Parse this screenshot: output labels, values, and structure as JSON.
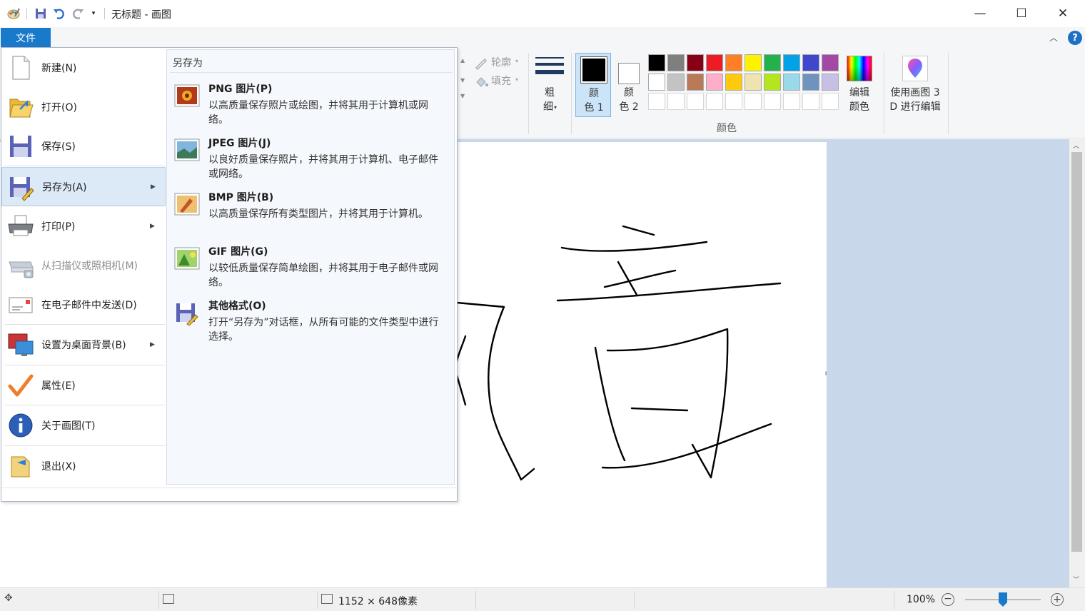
{
  "window": {
    "title": "无标题 - 画图",
    "minimize_glyph": "—",
    "maximize_glyph": "☐",
    "close_glyph": "✕"
  },
  "ribbon": {
    "file_tab": "文件",
    "outline_label": "轮廓",
    "fill_label": "填充",
    "size_label_1": "粗",
    "size_label_2": "细",
    "color1_label_1": "颜",
    "color1_label_2": "色 1",
    "color2_label_1": "颜",
    "color2_label_2": "色 2",
    "edit_colors_1": "编辑",
    "edit_colors_2": "颜色",
    "paint3d_1": "使用画图 3",
    "paint3d_2": "D 进行编辑",
    "colors_group": "颜色",
    "color1_value": "#000000",
    "color2_value": "#ffffff",
    "palette_row1": [
      "#000000",
      "#7f7f7f",
      "#880015",
      "#ed1c24",
      "#ff7f27",
      "#fff200",
      "#22b14c",
      "#00a2e8",
      "#3f48cc",
      "#a349a4"
    ],
    "palette_row2": [
      "#ffffff",
      "#c3c3c3",
      "#b97a57",
      "#ffaec9",
      "#ffc90e",
      "#efe4b0",
      "#b5e61d",
      "#99d9ea",
      "#7092be",
      "#c8bfe7"
    ]
  },
  "file_menu": {
    "items": [
      {
        "label": "新建(N)",
        "icon": "new-file-icon"
      },
      {
        "label": "打开(O)",
        "icon": "open-folder-icon"
      },
      {
        "label": "保存(S)",
        "icon": "save-icon"
      },
      {
        "label": "另存为(A)",
        "icon": "save-as-icon"
      },
      {
        "label": "打印(P)",
        "icon": "printer-icon"
      },
      {
        "label": "从扫描仪或照相机(M)",
        "icon": "scanner-icon"
      },
      {
        "label": "在电子邮件中发送(D)",
        "icon": "email-icon"
      },
      {
        "label": "设置为桌面背景(B)",
        "icon": "desktop-background-icon"
      },
      {
        "label": "属性(E)",
        "icon": "checkmark-icon"
      },
      {
        "label": "关于画图(T)",
        "icon": "info-icon"
      },
      {
        "label": "退出(X)",
        "icon": "exit-icon"
      }
    ],
    "submenu_title": "另存为",
    "submenu": [
      {
        "title": "PNG 图片(P)",
        "desc": "以高质量保存照片或绘图，并将其用于计算机或网络。"
      },
      {
        "title": "JPEG 图片(J)",
        "desc": "以良好质量保存照片，并将其用于计算机、电子邮件或网络。"
      },
      {
        "title": "BMP 图片(B)",
        "desc": "以高质量保存所有类型图片，并将其用于计算机。"
      },
      {
        "title": "GIF 图片(G)",
        "desc": "以较低质量保存简单绘图，并将其用于电子邮件或网络。"
      },
      {
        "title": "其他格式(O)",
        "desc": "打开“另存为”对话框，从所有可能的文件类型中进行选择。"
      }
    ]
  },
  "status": {
    "dimensions": "1152 × 648像素",
    "zoom": "100%",
    "zoom_level_percent": 100
  }
}
